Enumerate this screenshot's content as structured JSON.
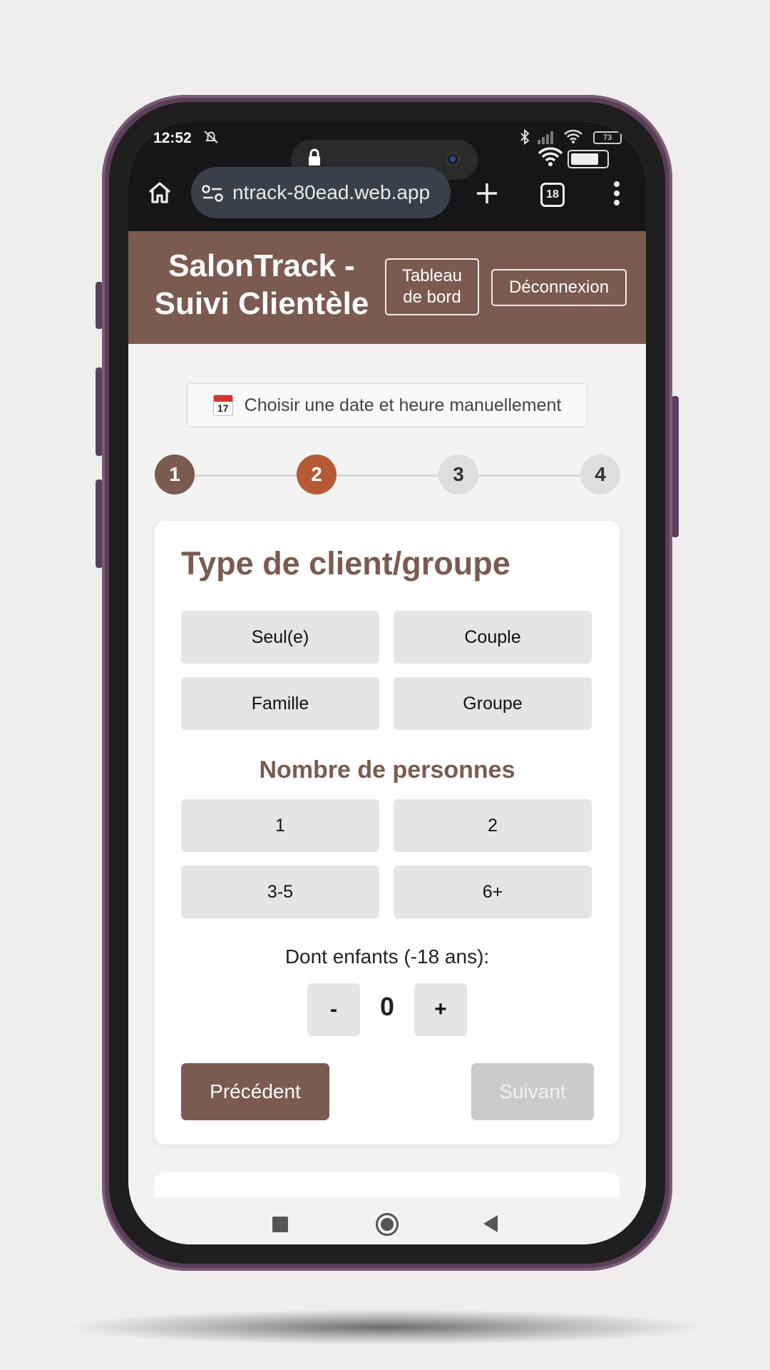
{
  "status_bar": {
    "time": "12:52",
    "battery_small": "73",
    "icons": [
      "bell-off-icon",
      "bluetooth-icon",
      "signal-icon",
      "wifi-icon",
      "battery-icon"
    ]
  },
  "browser": {
    "url": "ntrack-80ead.web.app",
    "tab_count": "18",
    "icons": [
      "home-icon",
      "site-settings-icon",
      "new-tab-plus-icon",
      "tabs-icon",
      "more-vert-icon"
    ]
  },
  "header": {
    "title": "SalonTrack - Suivi Clientèle",
    "dashboard_button": "Tableau de bord",
    "logout_button": "Déconnexion"
  },
  "date_picker": {
    "label": "Choisir une date et heure manuellement",
    "icon_text": "17"
  },
  "steps": [
    "1",
    "2",
    "3",
    "4"
  ],
  "current_step": 2,
  "client_type": {
    "title": "Type de client/groupe",
    "options": [
      "Seul(e)",
      "Couple",
      "Famille",
      "Groupe"
    ]
  },
  "people": {
    "title": "Nombre de personnes",
    "options": [
      "1",
      "2",
      "3-5",
      "6+"
    ]
  },
  "children": {
    "label": "Dont enfants (-18 ans):",
    "minus": "-",
    "value": "0",
    "plus": "+"
  },
  "nav_buttons": {
    "previous": "Précédent",
    "next": "Suivant"
  },
  "colors": {
    "brand": "#7b5a50",
    "active_step": "#b85935",
    "option_bg": "#e5e5e5",
    "disabled": "#cbcbcb"
  }
}
